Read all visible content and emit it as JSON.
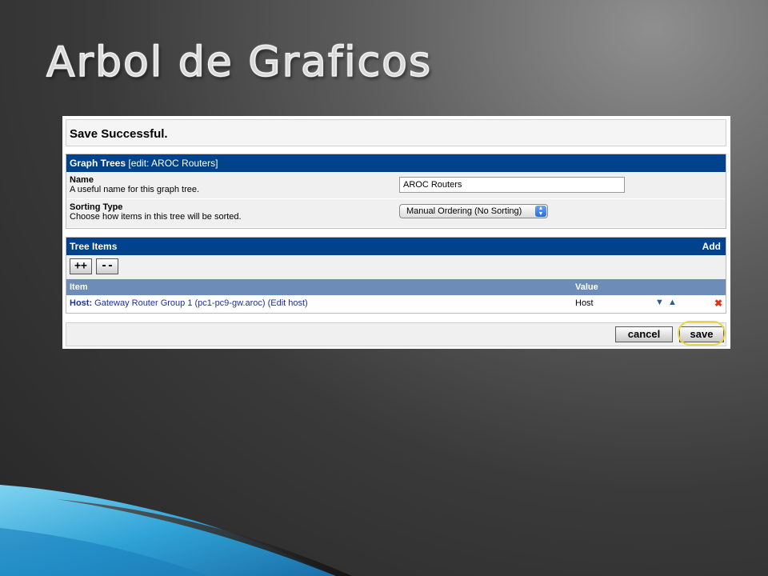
{
  "slide": {
    "title": "Arbol de Graficos"
  },
  "message": {
    "text": "Save Successful."
  },
  "graph_trees": {
    "header_bold": "Graph Trees",
    "header_rest": " [edit: AROC Routers]",
    "name_label": "Name",
    "name_desc": "A useful name for this graph tree.",
    "name_value": "AROC Routers",
    "sorting_label": "Sorting Type",
    "sorting_desc": "Choose how items in this tree will be sorted.",
    "sorting_value": "Manual Ordering (No Sorting)"
  },
  "tree_items": {
    "header": "Tree Items",
    "add_link": "Add",
    "expand_label": "++",
    "collapse_label": "--",
    "columns": {
      "item": "Item",
      "value": "Value"
    },
    "rows": [
      {
        "host_prefix": "Host:",
        "text": " Gateway Router Group 1 (pc1-pc9-gw.aroc) (Edit host)",
        "value": "Host",
        "delete": "✖"
      }
    ]
  },
  "actions": {
    "cancel": "cancel",
    "save": "save"
  },
  "colors": {
    "header_blue": "#00438c",
    "column_header": "#6d8db8",
    "highlight": "#ecd44a"
  }
}
